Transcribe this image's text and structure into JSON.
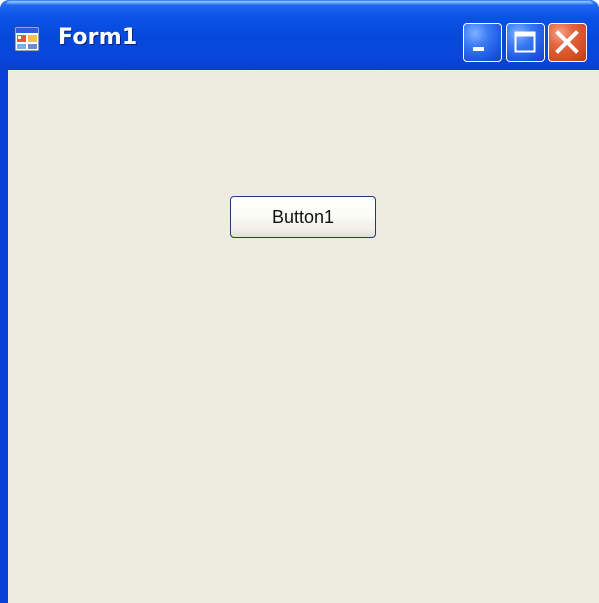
{
  "window": {
    "title": "Form1",
    "icon": "winforms-form-icon",
    "controls": [
      "minimize-icon",
      "maximize-icon",
      "close-icon"
    ]
  },
  "form": {
    "button1_label": "Button1"
  },
  "colors": {
    "titlebar": "#0a52e6",
    "client_background": "#eeebe1",
    "close_button": "#e6623d",
    "caption_button": "#3a7af5",
    "button_border": "#1e3d73"
  }
}
